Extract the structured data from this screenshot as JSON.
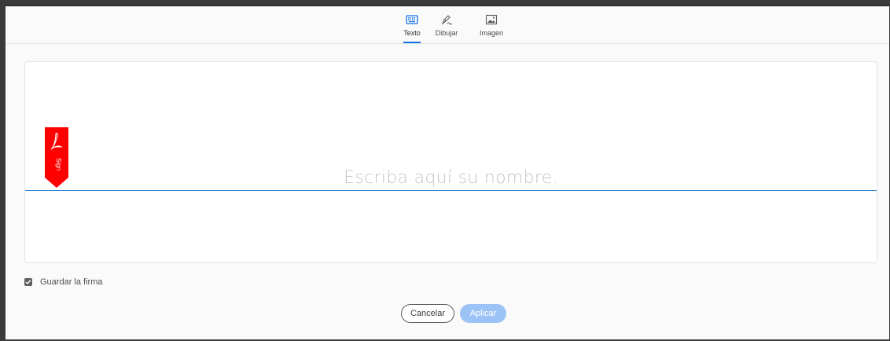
{
  "tabs": [
    {
      "label": "Texto",
      "icon": "keyboard-icon",
      "active": true
    },
    {
      "label": "Dibujar",
      "icon": "pen-draw-icon",
      "active": false
    },
    {
      "label": "Imagen",
      "icon": "image-icon",
      "active": false
    }
  ],
  "signature": {
    "placeholder": "Escriba aquí su nombre.",
    "flag_text": "Sign"
  },
  "save_signature": {
    "label": "Guardar la firma",
    "checked": true
  },
  "buttons": {
    "cancel": "Cancelar",
    "apply": "Aplicar"
  },
  "colors": {
    "accent": "#1473e6",
    "flag": "#ff0000",
    "apply_disabled": "#9cc3f6"
  }
}
